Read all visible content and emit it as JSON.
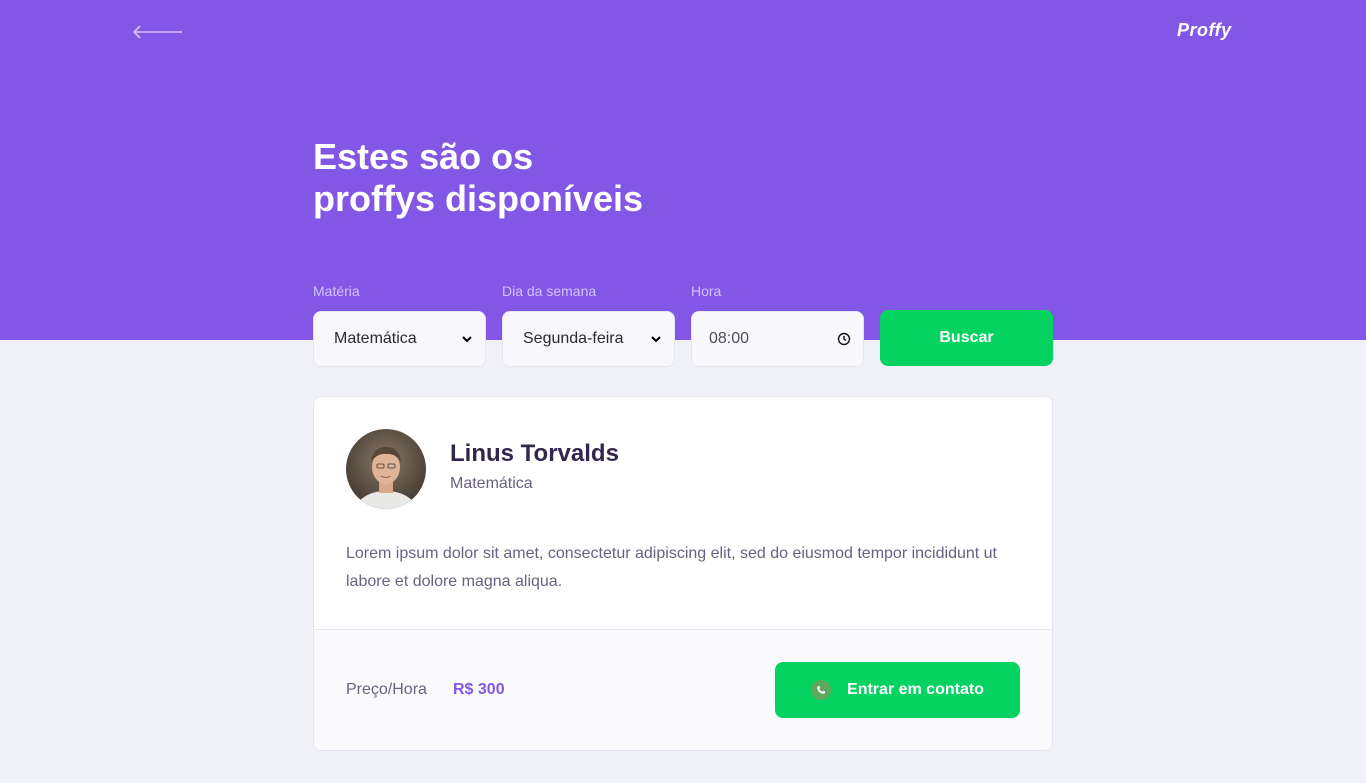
{
  "header": {
    "logo": "Proffy",
    "title_line1": "Estes são os",
    "title_line2": "proffys disponíveis"
  },
  "filters": {
    "subject": {
      "label": "Matéria",
      "value": "Matemática"
    },
    "weekday": {
      "label": "Dia da semana",
      "value": "Segunda-feira"
    },
    "time": {
      "label": "Hora",
      "value": "08:00"
    },
    "search_label": "Buscar"
  },
  "teacher": {
    "name": "Linus Torvalds",
    "subject": "Matemática",
    "bio": "Lorem ipsum dolor sit amet, consectetur adipiscing elit, sed do eiusmod tempor incididunt ut labore et dolore magna aliqua.",
    "price_label": "Preço/Hora",
    "price_value": "R$ 300",
    "contact_label": "Entrar em contato"
  },
  "colors": {
    "primary": "#8257E5",
    "secondary": "#04D361",
    "background": "#F0F0F7",
    "text_title": "#32264D",
    "text_base": "#6A6180"
  }
}
